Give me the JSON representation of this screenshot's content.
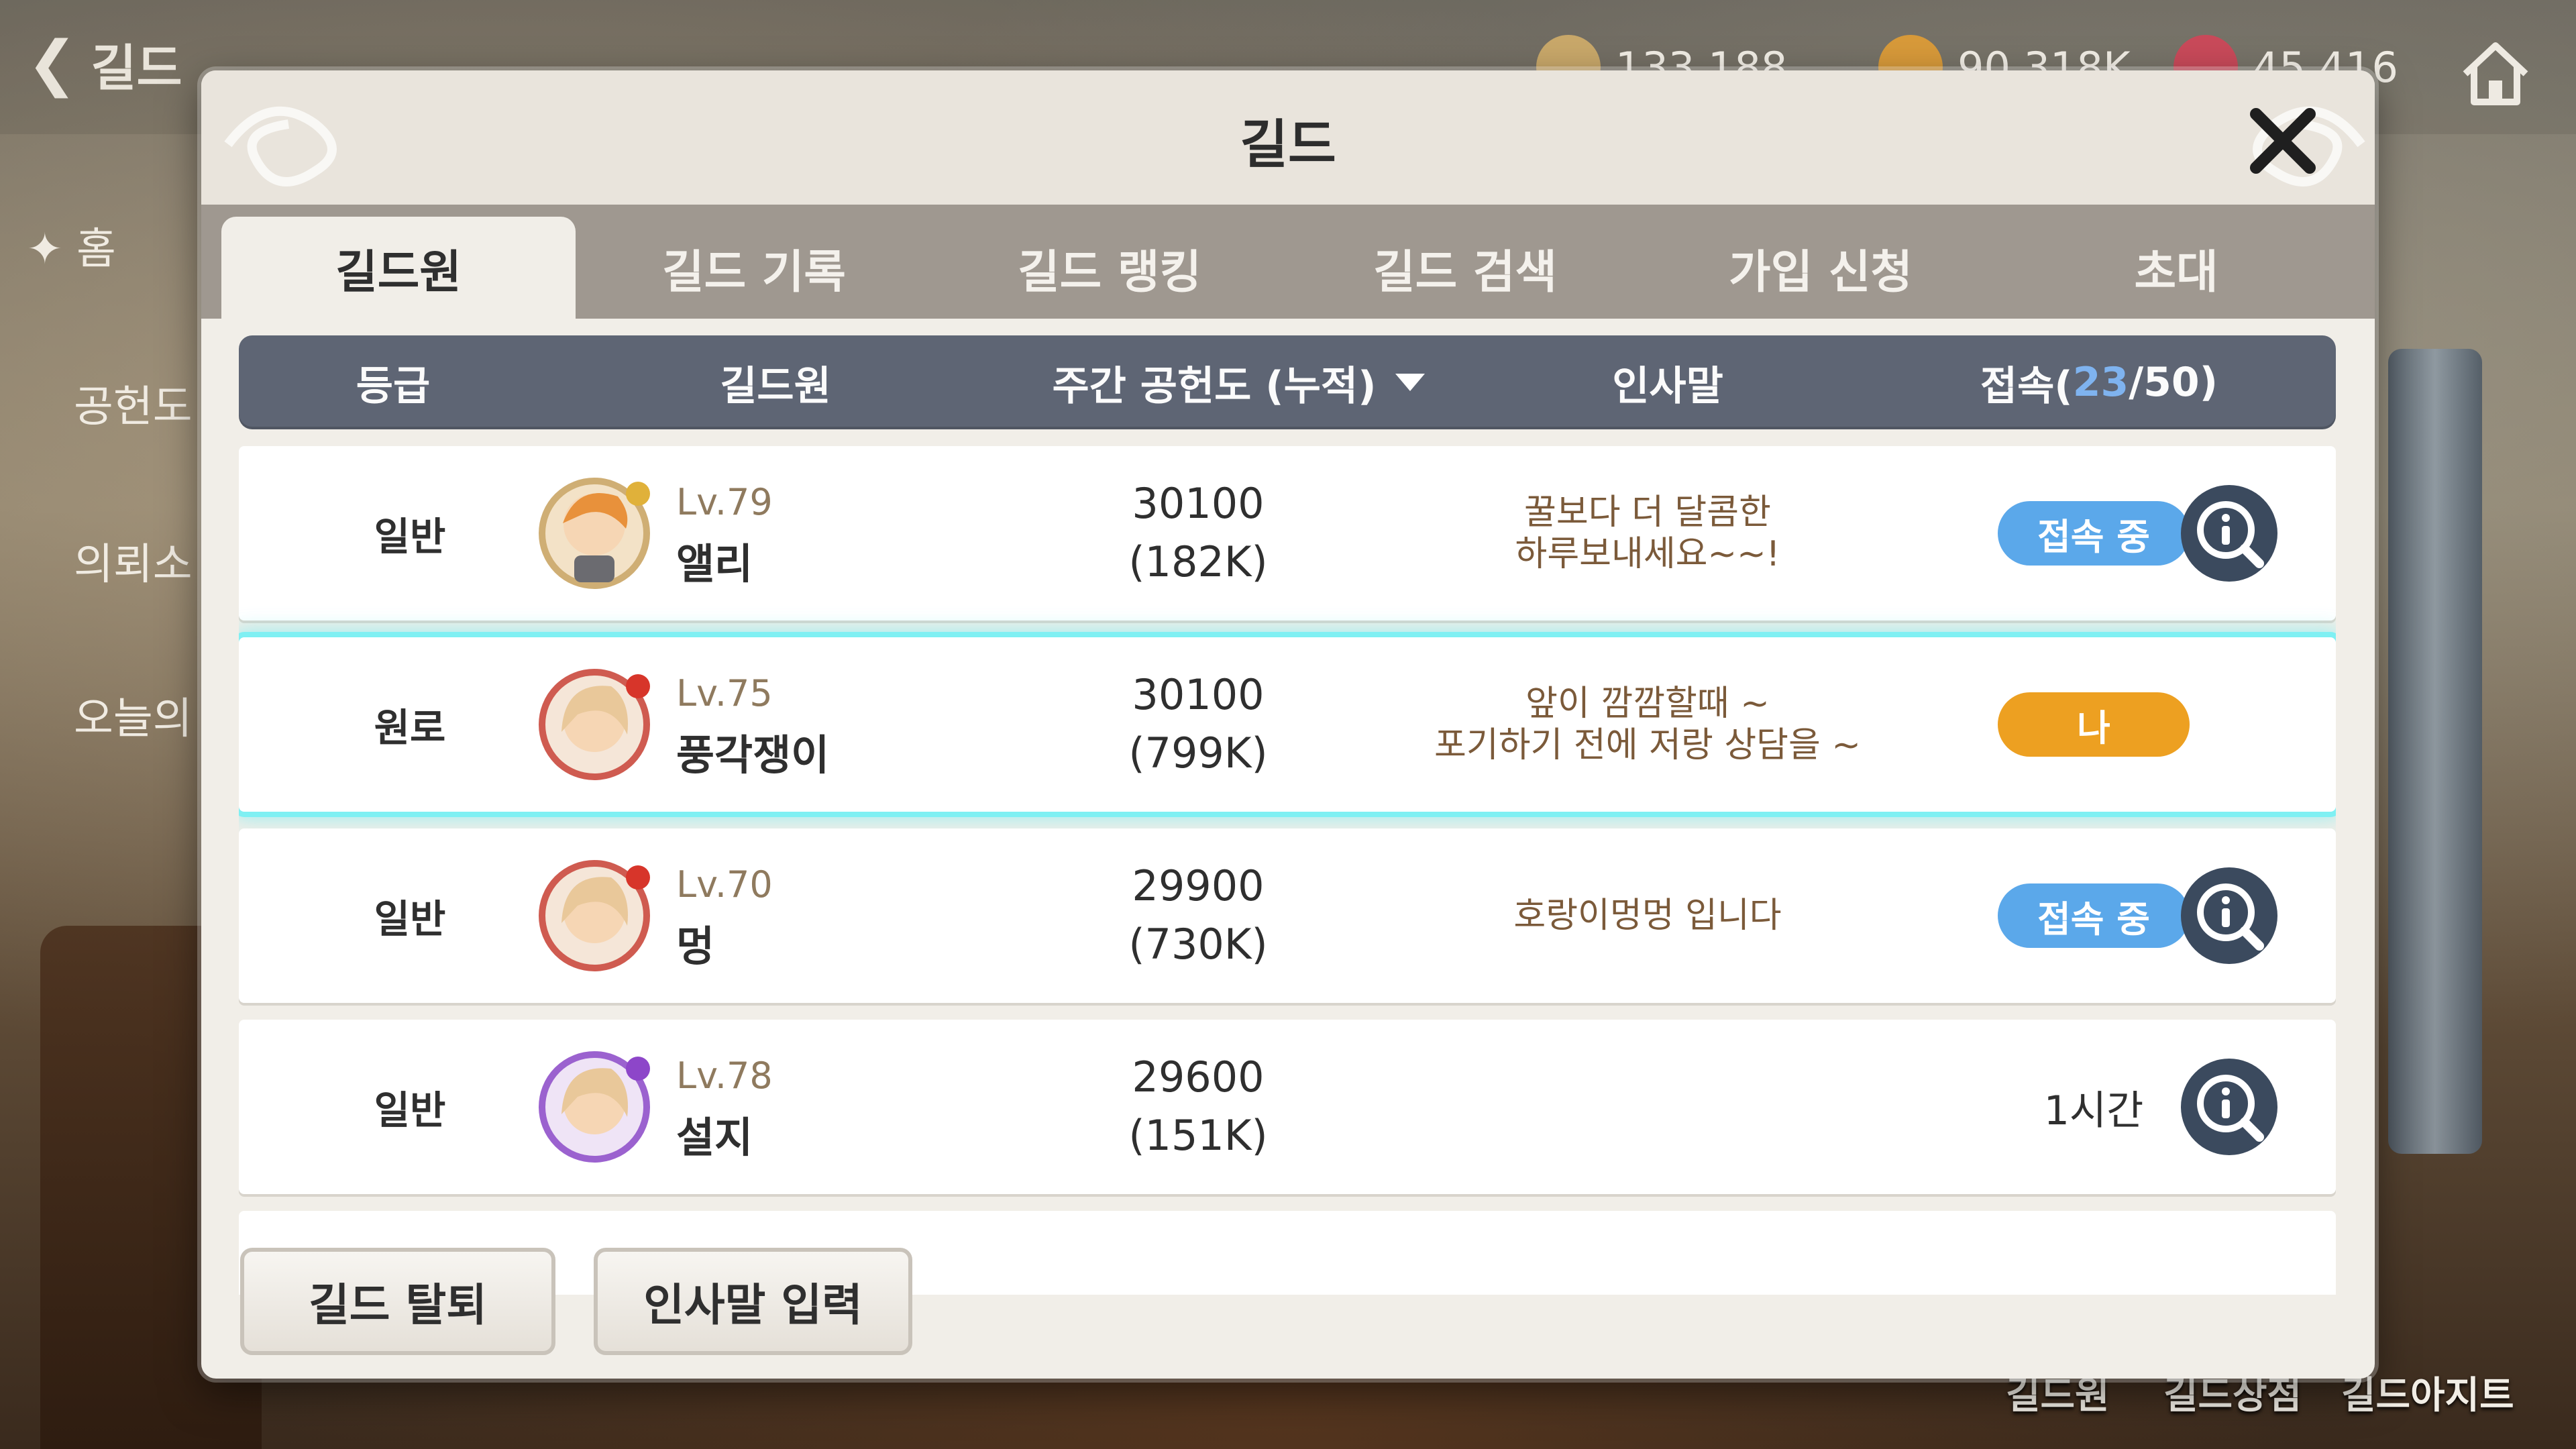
{
  "hud": {
    "back_label": "길드",
    "currencies": [
      {
        "value": "133,188",
        "color": "#c9a86a"
      },
      {
        "value": "90,318K",
        "color": "#d89a3a"
      },
      {
        "value": "45,416",
        "color": "#c94a5a"
      }
    ],
    "side_menu": [
      "홈",
      "공헌도",
      "의뢰소",
      "오늘의"
    ],
    "bottom_nav": [
      "길드원",
      "길드상점",
      "길드아지트"
    ]
  },
  "panel": {
    "title": "길드",
    "tabs": [
      {
        "label": "길드원",
        "active": true
      },
      {
        "label": "길드 기록",
        "active": false
      },
      {
        "label": "길드 랭킹",
        "active": false
      },
      {
        "label": "길드 검색",
        "active": false
      },
      {
        "label": "가입 신청",
        "active": false
      },
      {
        "label": "초대",
        "active": false
      }
    ],
    "table_header": {
      "grade": "등급",
      "member": "길드원",
      "contribution": "주간 공헌도 (누적)",
      "greeting": "인사말",
      "online_prefix": "접속(",
      "online_count": "23",
      "online_suffix": "/50)"
    },
    "members": [
      {
        "grade": "일반",
        "level": "Lv.79",
        "name": "앨리",
        "weekly": "30100",
        "total": "(182K)",
        "greeting_1": "꿀보다 더 달콤한",
        "greeting_2": "하루보내세요~~!",
        "status": "접속 중",
        "status_type": "online",
        "avatar_color": "#e8913b",
        "badge_color": "#e0b13a",
        "mine": false
      },
      {
        "grade": "원로",
        "level": "Lv.75",
        "name": "풍각쟁이",
        "weekly": "30100",
        "total": "(799K)",
        "greeting_1": "앞이 깜깜할때 ~",
        "greeting_2": "포기하기 전에 저랑 상담을 ~",
        "status": "나",
        "status_type": "me",
        "avatar_color": "#e9c89a",
        "badge_color": "#d7352a",
        "mine": true
      },
      {
        "grade": "일반",
        "level": "Lv.70",
        "name": "멍",
        "weekly": "29900",
        "total": "(730K)",
        "greeting_1": "호랑이멍멍 입니다",
        "greeting_2": "",
        "status": "접속 중",
        "status_type": "online",
        "avatar_color": "#e9c89a",
        "badge_color": "#d7352a",
        "mine": false
      },
      {
        "grade": "일반",
        "level": "Lv.78",
        "name": "설지",
        "weekly": "29600",
        "total": "(151K)",
        "greeting_1": "",
        "greeting_2": "",
        "status": "1시간",
        "status_type": "offline",
        "avatar_color": "#e9c89a",
        "badge_color": "#8d46c9",
        "mine": false
      }
    ],
    "footer": {
      "leave_label": "길드 탈퇴",
      "greeting_label": "인사말 입력"
    }
  },
  "colors": {
    "header_bar": "#5e6574",
    "tab_bar": "#9f9890",
    "online_pill": "#5ba8ea",
    "me_pill": "#eda021",
    "highlight": "#7ff0f3",
    "info_button": "#3b4a5e"
  }
}
